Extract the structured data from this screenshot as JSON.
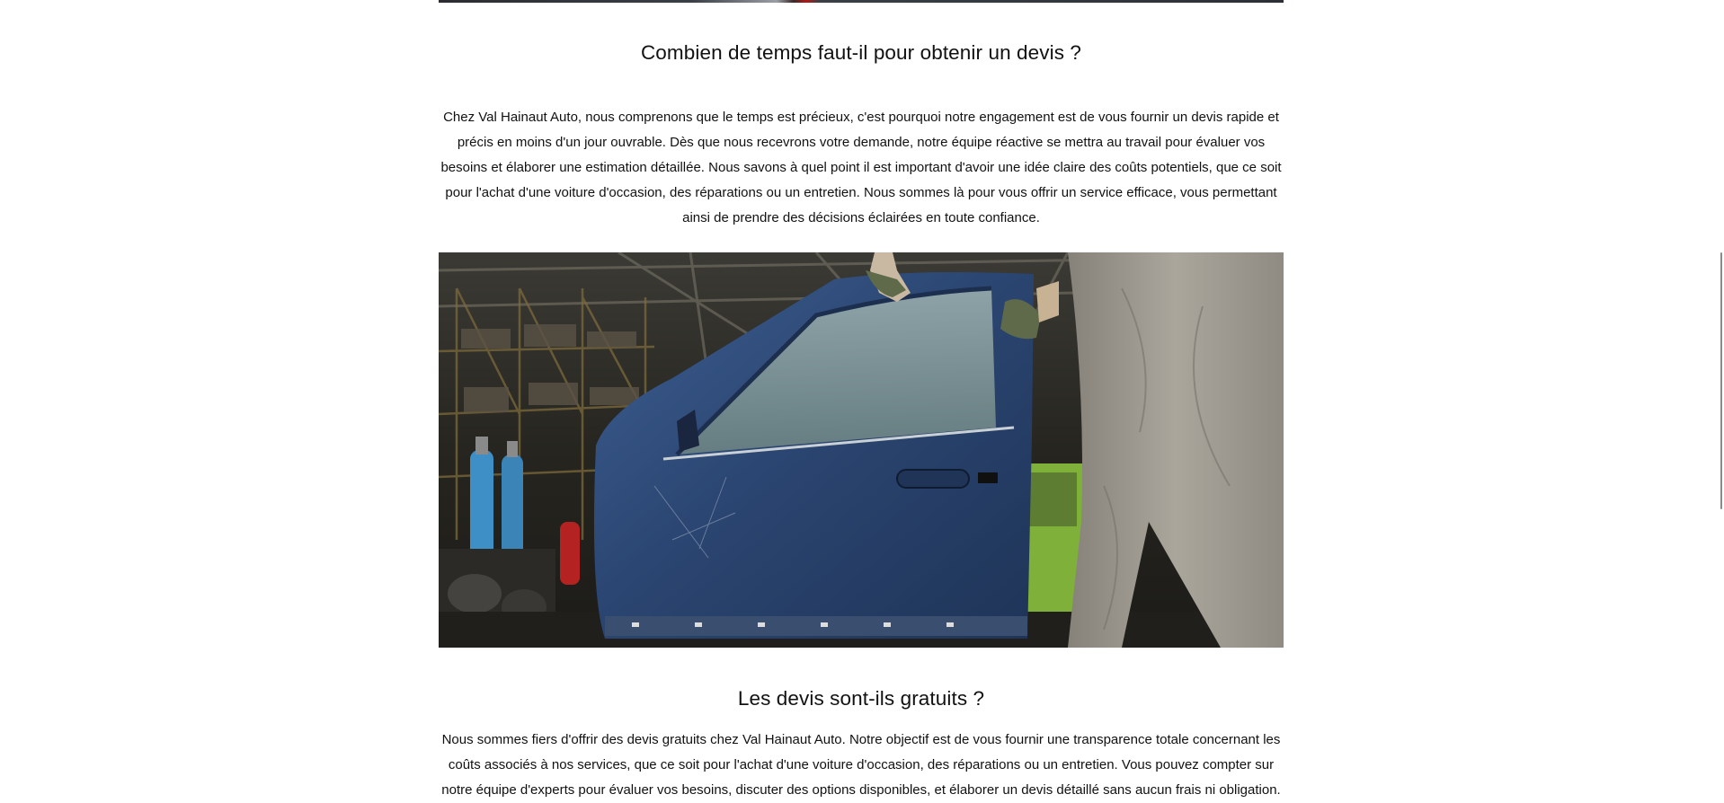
{
  "section1": {
    "heading": "Combien de temps faut-il pour obtenir un devis ?",
    "paragraph": "Chez Val Hainaut Auto, nous comprenons que le temps est précieux, c'est pourquoi notre engagement est de vous fournir un devis rapide et précis en moins d'un jour ouvrable. Dès que nous recevrons votre demande, notre équipe réactive se mettra au travail pour évaluer vos besoins et élaborer une estimation détaillée. Nous savons à quel point il est important d'avoir une idée claire des coûts potentiels, que ce soit pour l'achat d'une voiture d'occasion, des réparations ou un entretien. Nous sommes là pour vous offrir un service efficace, vous permettant ainsi de prendre des décisions éclairées en toute confiance."
  },
  "section2": {
    "heading": "Les devis sont-ils gratuits ?",
    "paragraph": "Nous sommes fiers d'offrir des devis gratuits chez Val Hainaut Auto. Notre objectif est de vous fournir une transparence totale concernant les coûts associés à nos services, que ce soit pour l'achat d'une voiture d'occasion, des réparations ou un entretien. Vous pouvez compter sur notre équipe d'experts pour évaluer vos besoins, discuter des options disponibles, et élaborer un devis détaillé sans aucun frais ni obligation."
  },
  "colors": {
    "background": "#ffffff",
    "text": "#111111",
    "door": "#2e4a78",
    "trousers": "#9b978d",
    "green_car": "#7fb03a",
    "gas_cylinder": "#3d8fc6"
  }
}
